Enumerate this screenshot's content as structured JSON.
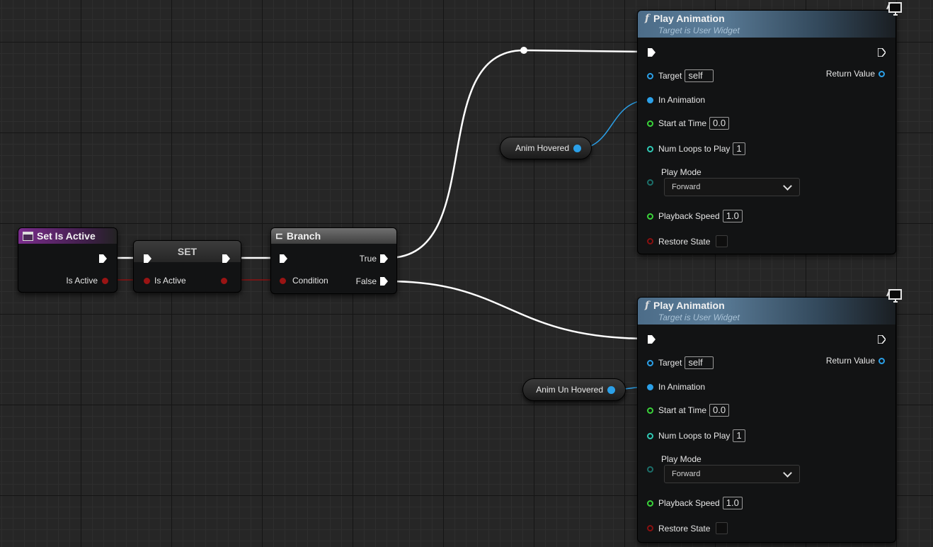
{
  "nodes": {
    "set_is_active_event": {
      "title": "Set Is Active",
      "pin_is_active": "Is Active"
    },
    "set_node": {
      "title": "SET",
      "pin_is_active": "Is Active"
    },
    "branch": {
      "title": "Branch",
      "pin_condition": "Condition",
      "pin_true": "True",
      "pin_false": "False"
    },
    "play_animation_1": {
      "title": "Play Animation",
      "subtitle": "Target is User Widget",
      "target_label": "Target",
      "target_value": "self",
      "return_label": "Return Value",
      "in_animation_label": "In Animation",
      "start_time_label": "Start at Time",
      "start_time_value": "0.0",
      "num_loops_label": "Num Loops to Play",
      "num_loops_value": "1",
      "play_mode_label": "Play Mode",
      "play_mode_value": "Forward",
      "playback_speed_label": "Playback Speed",
      "playback_speed_value": "1.0",
      "restore_state_label": "Restore State"
    },
    "play_animation_2": {
      "title": "Play Animation",
      "subtitle": "Target is User Widget",
      "target_label": "Target",
      "target_value": "self",
      "return_label": "Return Value",
      "in_animation_label": "In Animation",
      "start_time_label": "Start at Time",
      "start_time_value": "0.0",
      "num_loops_label": "Num Loops to Play",
      "num_loops_value": "1",
      "play_mode_label": "Play Mode",
      "play_mode_value": "Forward",
      "playback_speed_label": "Playback Speed",
      "playback_speed_value": "1.0",
      "restore_state_label": "Restore State"
    },
    "anim_hovered": {
      "label": "Anim Hovered"
    },
    "anim_un_hovered": {
      "label": "Anim Un Hovered"
    }
  },
  "colors": {
    "exec_wire": "#ffffff",
    "bool_wire": "#8a1010",
    "object_wire": "#2ba0e8",
    "event_header": "#7a2c8c",
    "function_header": "#4c6c88"
  }
}
